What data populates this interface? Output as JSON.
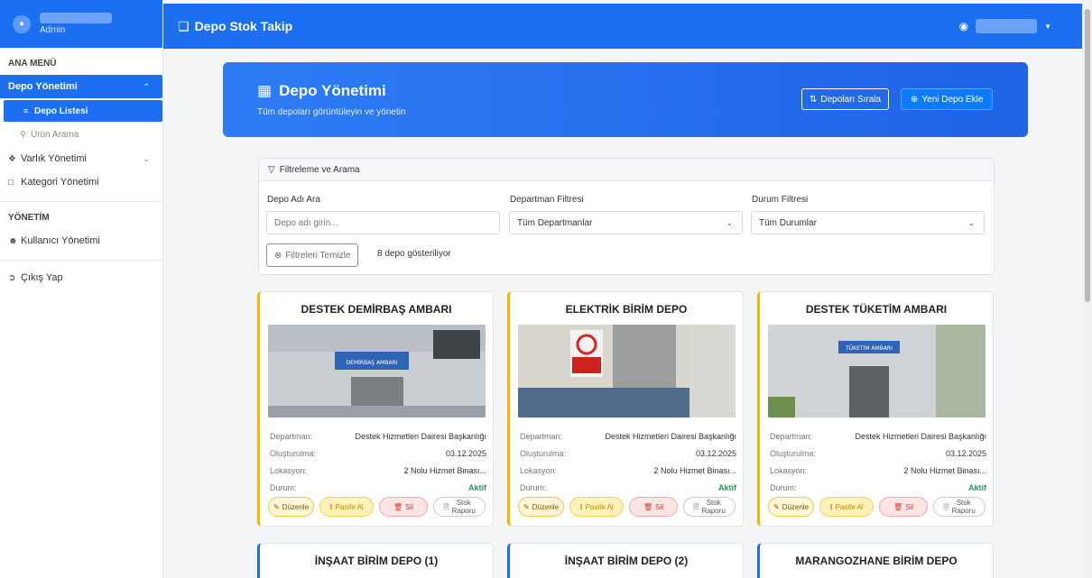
{
  "sidebar": {
    "role": "Admin",
    "section_main": "ANA MENÜ",
    "depo_yonetimi": "Depo Yönetimi",
    "depo_listesi": "Depo Listesi",
    "urun_arama": "Ürün Arama",
    "varlik_yonetimi": "Varlık Yönetimi",
    "kategori_yonetimi": "Kategori Yönetimi",
    "section_admin": "YÖNETİM",
    "kullanici_yonetimi": "Kullanıcı Yönetimi",
    "cikis": "Çıkış Yap"
  },
  "topnav": {
    "brand": "Depo Stok Takip"
  },
  "banner": {
    "title": "Depo Yönetimi",
    "subtitle": "Tüm depoları görüntüleyin ve yönetin",
    "sort_label": "Depoları Sırala",
    "add_label": "Yeni Depo Ekle"
  },
  "filter": {
    "header": "Filtreleme ve Arama",
    "name_label": "Depo Adı Ara",
    "name_placeholder": "Depo adı girin...",
    "dept_label": "Departman Filtresi",
    "dept_value": "Tüm Departmanlar",
    "status_label": "Durum Filtresi",
    "status_value": "Tüm Durumlar",
    "clear_label": "Filtreleri Temizle",
    "count_text": "8 depo gösteriliyor"
  },
  "card_labels": {
    "departman": "Departman:",
    "olusturulma": "Oluşturulma:",
    "lokasyon": "Lokasyon:",
    "durum": "Durum:",
    "edit": "Düzenle",
    "pasif": "Pasife Al",
    "delete": "Sil",
    "report_1": "Stok",
    "report_2": "Raporu"
  },
  "cards": [
    {
      "title": "DESTEK DEMİRBAŞ AMBARI",
      "departman": "Destek Hizmetleri Dairesi Başkanlığı",
      "olusturulma": "03.12.2025",
      "lokasyon": "2 Nolu Hizmet Binası...",
      "durum": "Aktif",
      "sign": "DEMİRBAŞ AMBARI"
    },
    {
      "title": "ELEKTRİK BİRİM DEPO",
      "departman": "Destek Hizmetleri Dairesi Başkanlığı",
      "olusturulma": "03.12.2025",
      "lokasyon": "2 Nolu Hizmet Binası...",
      "durum": "Aktif",
      "sign": ""
    },
    {
      "title": "DESTEK TÜKETİM AMBARI",
      "departman": "Destek Hizmetleri Dairesi Başkanlığı",
      "olusturulma": "03.12.2025",
      "lokasyon": "2 Nolu Hizmet Binası...",
      "durum": "Aktif",
      "sign": "TÜKETİM AMBARI"
    },
    {
      "title": "İNŞAAT BİRİM DEPO (1)"
    },
    {
      "title": "İNŞAAT BİRİM DEPO (2)"
    },
    {
      "title": "MARANGOZHANE BİRİM DEPO"
    }
  ],
  "colors": {
    "primary": "#1d6ff2",
    "accent_yellow": "#f4b400",
    "aktif": "#1f9d55"
  }
}
